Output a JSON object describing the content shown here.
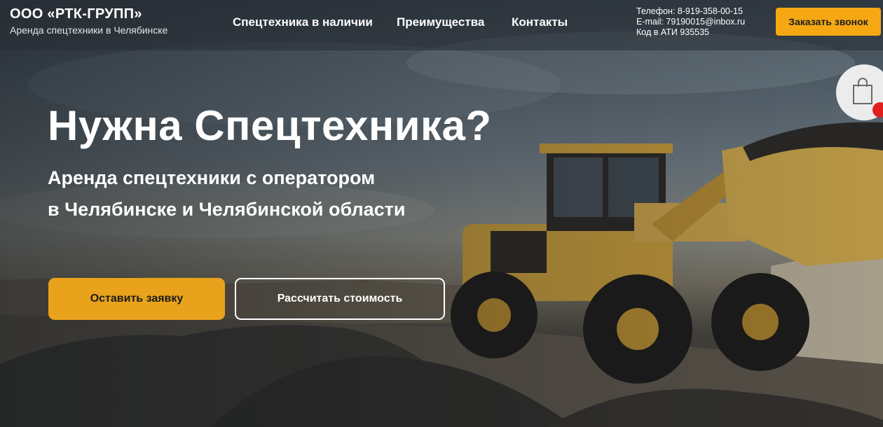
{
  "header": {
    "company": "ООО «РТК-ГРУПП»",
    "tagline": "Аренда спецтехники в Челябинске",
    "nav": [
      {
        "label": "Спецтехника в наличии"
      },
      {
        "label": "Преимущества"
      },
      {
        "label": "Контакты"
      }
    ],
    "contacts": {
      "phone": "Телефон: 8-919-358-00-15",
      "email": "E-mail: 79190015@inbox.ru",
      "ati": "Код в АТИ 935535"
    },
    "call_button": "Заказать звонок"
  },
  "hero": {
    "title": "Нужна Спецтехника?",
    "subtitle_line1": "Аренда спецтехники с оператором",
    "subtitle_line2": "в Челябинске и Челябинской области",
    "primary_button": "Оставить заявку",
    "secondary_button": "Рассчитать стоимость"
  },
  "cart": {
    "icon": "shopping-bag-icon"
  },
  "colors": {
    "accent": "#f5a814",
    "accent_button": "#e8a21b",
    "badge": "#e0201f"
  }
}
